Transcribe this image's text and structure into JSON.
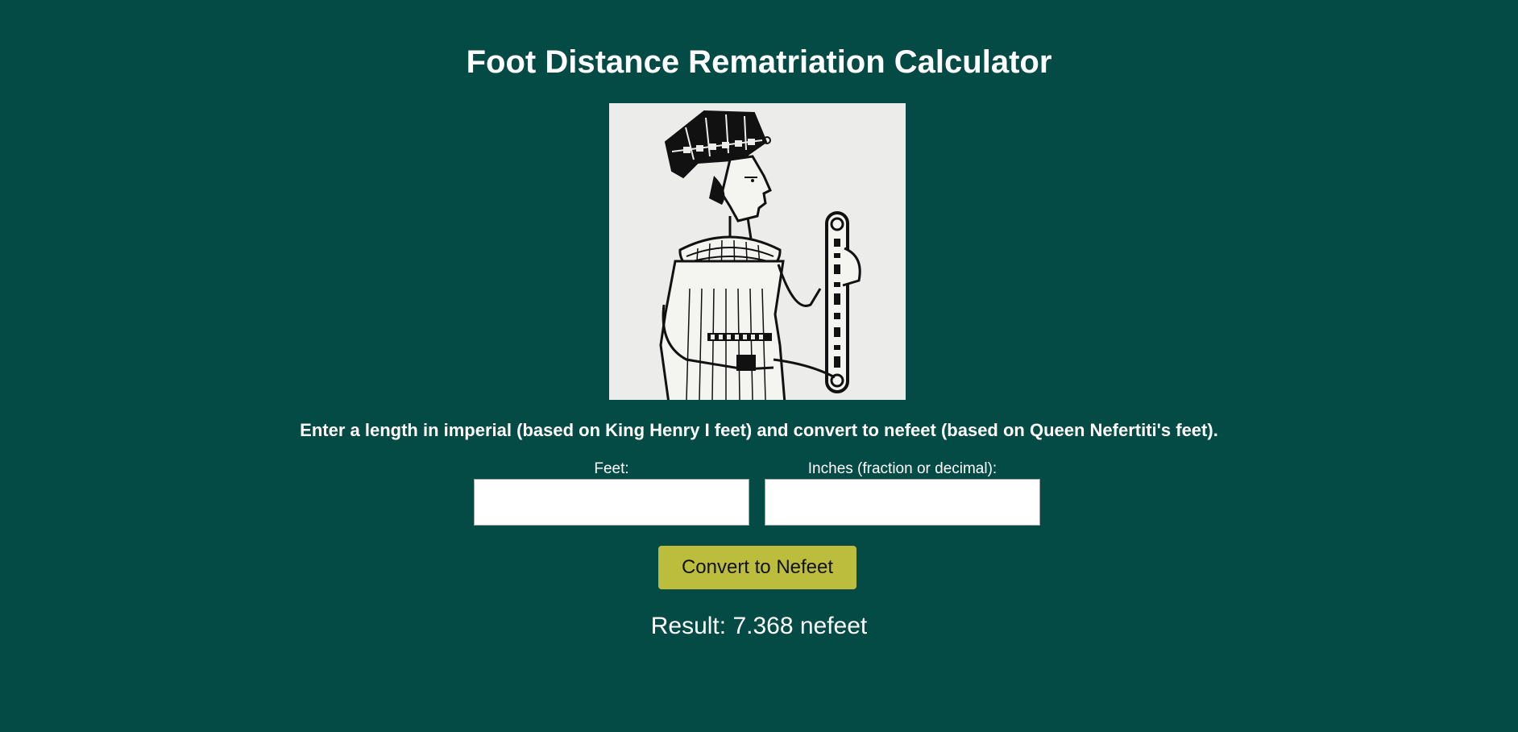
{
  "page": {
    "title": "Foot Distance Rematriation Calculator",
    "instructions": "Enter a length in imperial (based on King Henry I feet) and convert to nefeet (based on Queen Nefertiti's feet)."
  },
  "figure": {
    "subject": "Queen Nefertiti holding a measuring rod"
  },
  "form": {
    "feet": {
      "label": "Feet:",
      "value": "",
      "placeholder": ""
    },
    "inches": {
      "label": "Inches (fraction or decimal):",
      "value": "",
      "placeholder": ""
    },
    "button_label": "Convert to Nefeet"
  },
  "result": {
    "text": "Result: 7.368 nefeet"
  },
  "colors": {
    "background": "#044a45",
    "button": "#bcbd3c",
    "text": "#ffffff"
  }
}
